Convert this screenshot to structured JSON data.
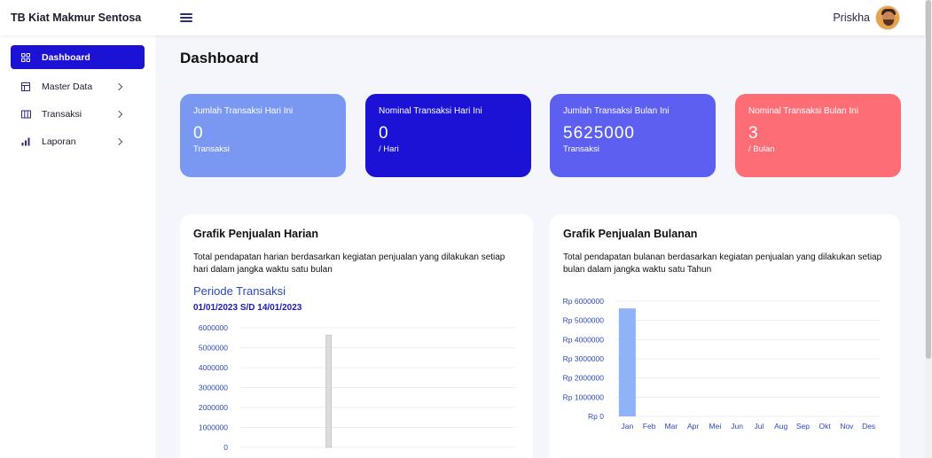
{
  "app": {
    "brand": "TB Kiat Makmur Sentosa"
  },
  "header": {
    "user_name": "Priskha"
  },
  "sidebar": {
    "items": [
      {
        "label": "Dashboard",
        "icon": "grid-icon",
        "active": true
      },
      {
        "label": "Master Data",
        "icon": "table-icon",
        "has_chevron": true
      },
      {
        "label": "Transaksi",
        "icon": "columns-icon",
        "has_chevron": true
      },
      {
        "label": "Laporan",
        "icon": "bar-chart-icon",
        "has_chevron": true
      }
    ]
  },
  "main": {
    "title": "Dashboard",
    "cards": [
      {
        "label": "Jumlah Transaksi Hari Ini",
        "value": "0",
        "unit": "Transaksi",
        "color": "#7a98f2"
      },
      {
        "label": "Nominal Transaksi Hari Ini",
        "value": "0",
        "unit": "/ Hari",
        "color": "#1b12d6"
      },
      {
        "label": "Jumlah Transaksi Bulan Ini",
        "value": "5625000",
        "unit": "Transaksi",
        "color": "#5c5ff0"
      },
      {
        "label": "Nominal Transaksi Bulan Ini",
        "value": "3",
        "unit": "/ Bulan",
        "color": "#fd6d76"
      }
    ],
    "daily_panel": {
      "title": "Grafik Penjualan Harian",
      "description": "Total pendapatan harian berdasarkan kegiatan penjualan yang dilakukan setiap hari dalam jangka waktu satu bulan",
      "period_label": "Periode Transaksi",
      "period_range": "01/01/2023 S/D 14/01/2023"
    },
    "monthly_panel": {
      "title": "Grafik Penjualan Bulanan",
      "description": "Total pendapatan bulanan berdasarkan kegiatan penjualan yang dilakukan setiap bulan dalam jangka waktu satu Tahun"
    }
  },
  "chart_data": [
    {
      "type": "bar",
      "categories": [
        "",
        "",
        "",
        "",
        "",
        "",
        "",
        "",
        "",
        "",
        "",
        "",
        "",
        ""
      ],
      "series": [
        {
          "values": [
            0,
            0,
            0,
            0,
            5625000,
            0,
            0,
            0,
            0,
            0,
            0,
            0,
            0,
            0
          ]
        }
      ],
      "ytick_labels": [
        "0",
        "1000000",
        "2000000",
        "3000000",
        "4000000",
        "5000000",
        "6000000"
      ],
      "ylim": [
        0,
        6000000
      ],
      "bar_color": "#dcdcdc",
      "label_color": "#2e49b8"
    },
    {
      "type": "bar",
      "categories": [
        "Jan",
        "Feb",
        "Mar",
        "Apr",
        "Mei",
        "Jun",
        "Jul",
        "Aug",
        "Sep",
        "Okt",
        "Nov",
        "Des"
      ],
      "series": [
        {
          "values": [
            5625000,
            0,
            0,
            0,
            0,
            0,
            0,
            0,
            0,
            0,
            0,
            0
          ]
        }
      ],
      "ytick_labels": [
        "Rp 0",
        "Rp 1000000",
        "Rp 2000000",
        "Rp 3000000",
        "Rp 4000000",
        "Rp 5000000",
        "Rp 6000000"
      ],
      "ylim": [
        0,
        6000000
      ],
      "bar_color": "#8fb2f8",
      "label_color": "#2e49b8"
    }
  ]
}
